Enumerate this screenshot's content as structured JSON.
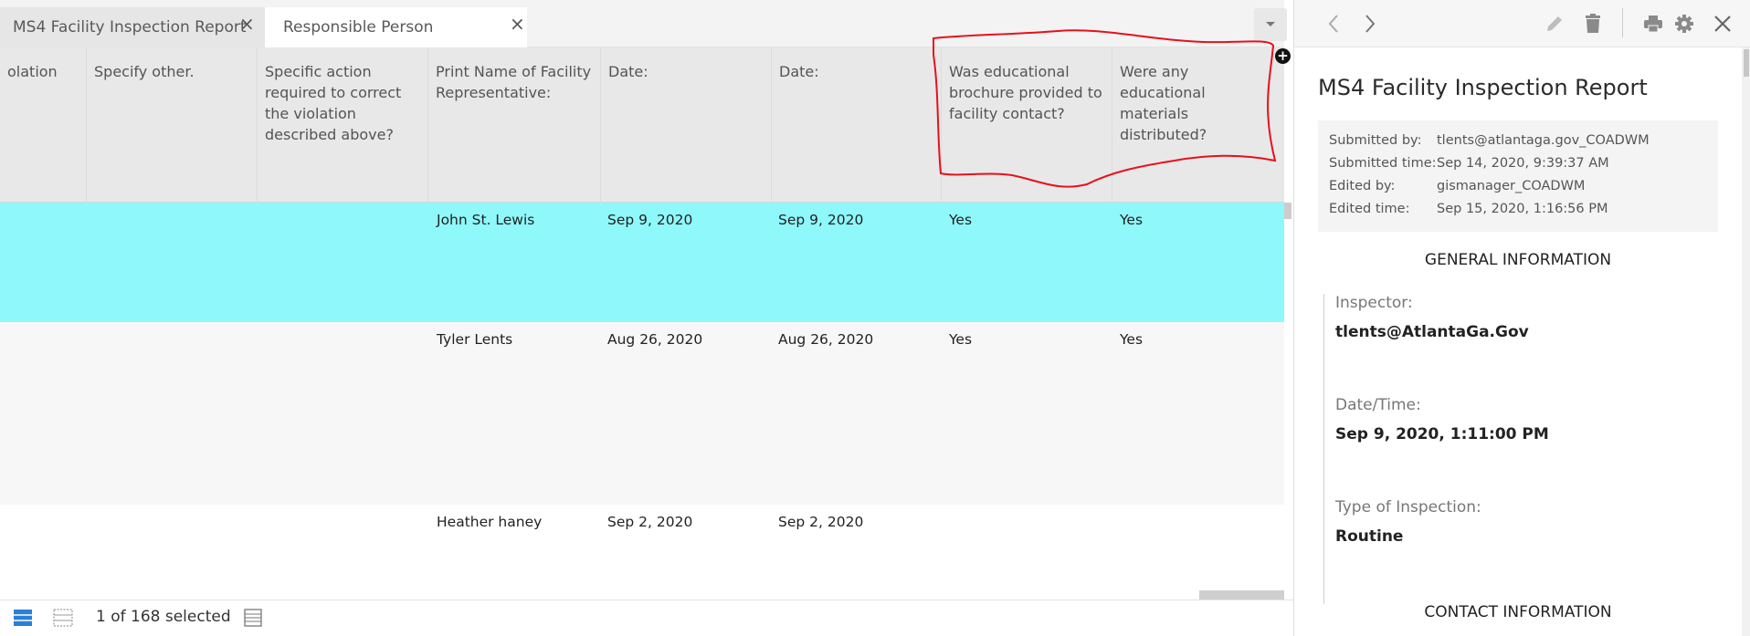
{
  "tabs": [
    {
      "label": "MS4 Facility Inspection Report",
      "close": "×"
    },
    {
      "label": "Responsible Person",
      "close": "×"
    }
  ],
  "table": {
    "columns": [
      "olation",
      "Specify other.",
      "Specific action required to correct the violation described above?",
      "Print Name of Facility Representative:",
      "Date:",
      "Date:",
      "Was educational brochure provided to facility contact?",
      "Were any educational materials distributed?"
    ],
    "rows": [
      {
        "representative": "John St. Lewis",
        "date1": "Sep 9, 2020",
        "date2": "Sep 9, 2020",
        "brochure": "Yes",
        "materials": "Yes",
        "selected": true
      },
      {
        "representative": "Tyler Lents",
        "date1": "Aug 26, 2020",
        "date2": "Aug 26, 2020",
        "brochure": "Yes",
        "materials": "Yes",
        "selected": false
      },
      {
        "representative": "Heather haney",
        "date1": "Sep 2, 2020",
        "date2": "Sep 2, 2020",
        "brochure": "",
        "materials": "",
        "selected": false
      }
    ],
    "selection_status": "1 of 168 selected"
  },
  "detail": {
    "title": "MS4 Facility Inspection Report",
    "meta": [
      {
        "key": "Submitted by:",
        "value": "tlents@atlantaga.gov_COADWM"
      },
      {
        "key": "Submitted time:",
        "value": "Sep 14, 2020, 9:39:37 AM"
      },
      {
        "key": "Edited by:",
        "value": "gismanager_COADWM"
      },
      {
        "key": "Edited time:",
        "value": "Sep 15, 2020, 1:16:56 PM"
      }
    ],
    "sections": {
      "general": "GENERAL INFORMATION",
      "contact": "CONTACT INFORMATION"
    },
    "fields": [
      {
        "label": "Inspector:",
        "value": "tlents@AtlantaGa.Gov"
      },
      {
        "label": "Date/Time:",
        "value": "Sep 9, 2020, 1:11:00 PM"
      },
      {
        "label": "Type of Inspection:",
        "value": "Routine"
      }
    ]
  },
  "colors": {
    "selected_row": "#8ff8fb",
    "annotation": "#e8101b"
  },
  "icons": [
    "chevron-left-icon",
    "chevron-right-icon",
    "pencil-icon",
    "trash-icon",
    "print-icon",
    "gear-icon",
    "close-icon",
    "add-column-icon",
    "dropdown-caret-icon",
    "select-all-icon",
    "clear-selection-icon",
    "table-options-icon"
  ]
}
